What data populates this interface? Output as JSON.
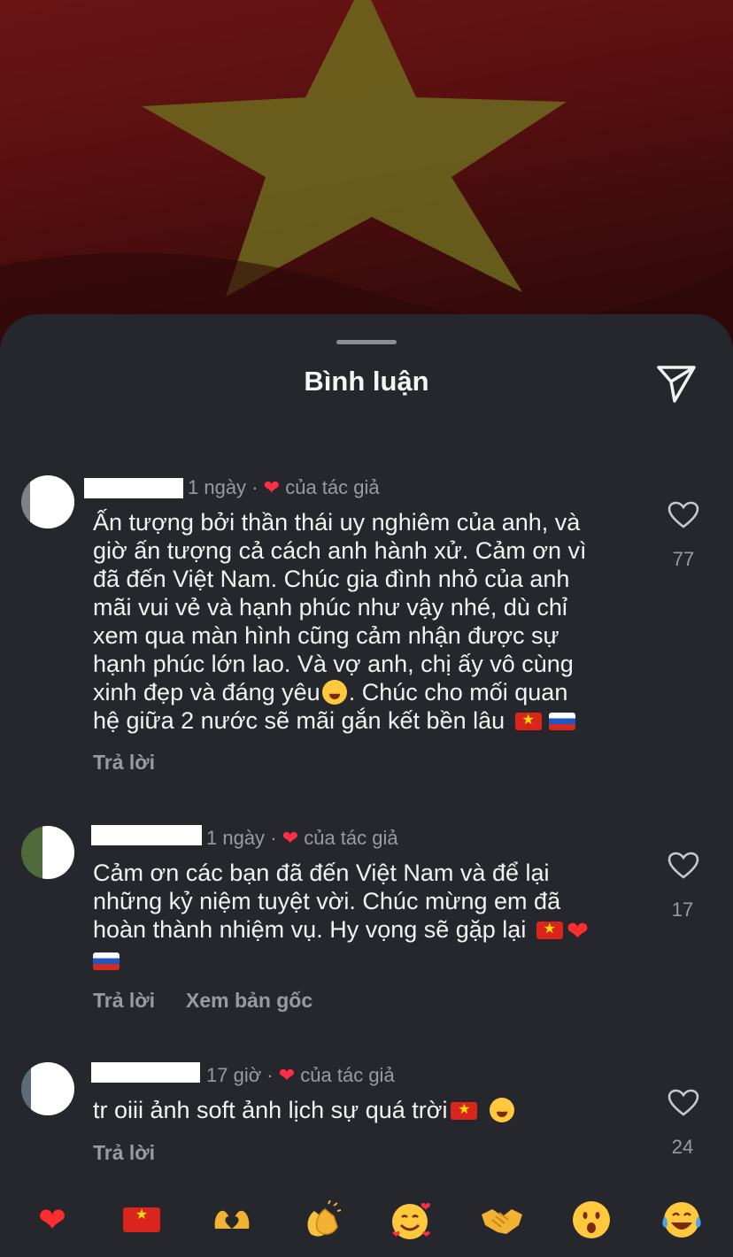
{
  "header": {
    "title": "Bình luận",
    "share_icon": "send-icon"
  },
  "comments": [
    {
      "meta_time": "1 ngày",
      "meta_sep": "·",
      "meta_author": "của tác giả",
      "text_lines": [
        "Ấn tượng bởi thần thái uy nghiêm của anh, và",
        "giờ ấn tượng cả cách anh hành xử. Cảm ơn vì",
        "đã đến Việt Nam. Chúc gia đình nhỏ của anh",
        "mãi vui vẻ và hạnh phúc như vậy nhé, dù chỉ",
        "xem qua màn hình cũng cảm nhận được sự",
        "hạnh phúc lớn lao. Và vợ anh, chị ấy vô cùng"
      ],
      "line7_a": "xinh đẹp và đáng yêu",
      "line7_b": ". Chúc cho mối quan",
      "line8": "hệ giữa 2 nước sẽ mãi gắn kết bền lâu",
      "reply_label": "Trả lời",
      "like_count": "77"
    },
    {
      "meta_time": "1 ngày",
      "meta_sep": "·",
      "meta_author": "của tác giả",
      "text_lines": [
        "Cảm ơn các bạn đã đến Việt Nam và để lại",
        "những kỷ niệm tuyệt vời. Chúc mừng em đã"
      ],
      "line3": "hoàn thành nhiệm vụ. Hy vọng sẽ gặp lại",
      "reply_label": "Trả lời",
      "see_original_label": "Xem bản gốc",
      "like_count": "17"
    },
    {
      "meta_time": "17 giờ",
      "meta_sep": "·",
      "meta_author": "của tác giả",
      "text": "tr oiii ảnh soft ảnh lịch sự quá trời",
      "reply_label": "Trả lời",
      "like_count": "24"
    }
  ],
  "reactions": [
    "red-heart",
    "vietnam-flag",
    "heart-hands",
    "clapping-hands",
    "smiling-face-with-hearts",
    "handshake",
    "face-with-open-mouth",
    "face-with-tears-of-joy"
  ],
  "colors": {
    "sheet_bg": "#26272c",
    "heart_red": "#ff2d46",
    "meta_gray": "#9a9ba0"
  }
}
